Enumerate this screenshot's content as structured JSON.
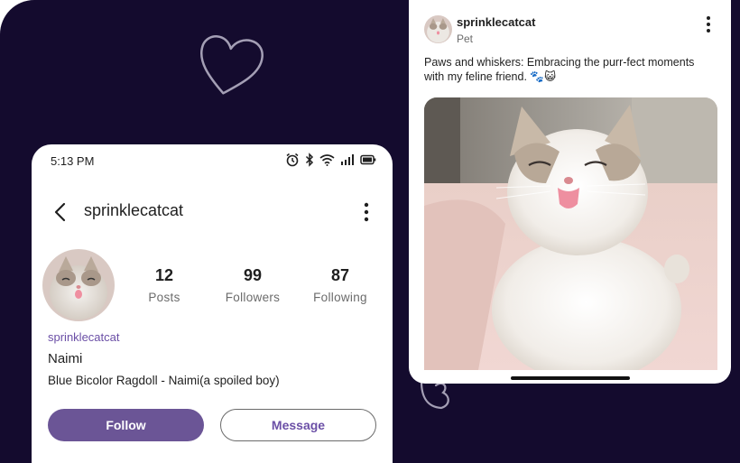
{
  "profile": {
    "status_time": "5:13 PM",
    "title": "sprinklecatcat",
    "stats": [
      {
        "value": "12",
        "label": "Posts"
      },
      {
        "value": "99",
        "label": "Followers"
      },
      {
        "value": "87",
        "label": "Following"
      }
    ],
    "handle": "sprinklecatcat",
    "display_name": "Naimi",
    "bio": "Blue Bicolor Ragdoll - Naimi(a spoiled boy)",
    "follow_label": "Follow",
    "message_label": "Message"
  },
  "post": {
    "username": "sprinklecatcat",
    "subtitle": "Pet",
    "caption": "Paws and whiskers: Embracing the purr-fect moments with my feline friend. 🐾😺"
  },
  "colors": {
    "background": "#140b2e",
    "accent": "#6b5596",
    "handle": "#6b4fa6"
  }
}
